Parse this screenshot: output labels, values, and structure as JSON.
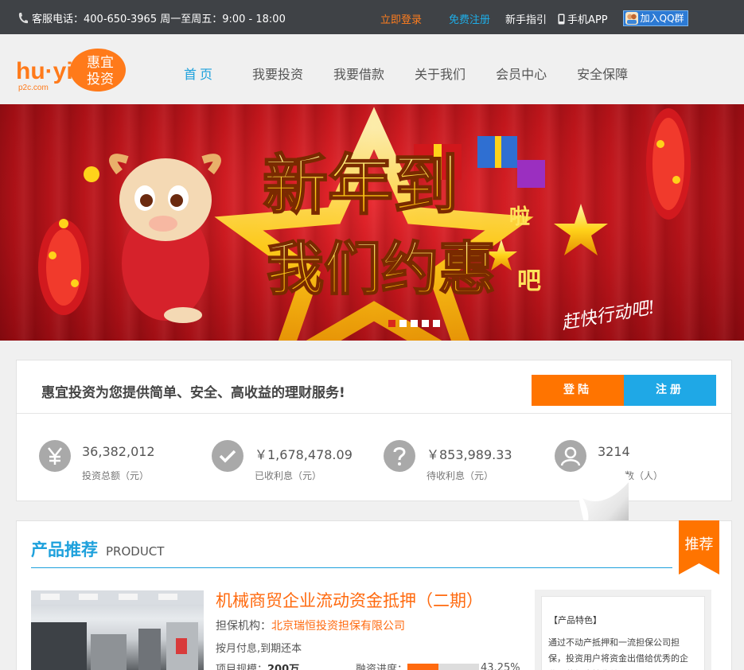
{
  "topbar": {
    "hotline": "客服电话：400-650-3965 周一至周五：9:00 - 18:00",
    "login": "立即登录",
    "register": "免费注册",
    "guide": "新手指引",
    "app": "手机APP",
    "qq_group": "加入QQ群"
  },
  "logo": {
    "en": "hu·yi",
    "domain": "p2c.com",
    "cn_line1": "惠宜",
    "cn_line2": "投资"
  },
  "nav": {
    "items": [
      "首页",
      "我要投资",
      "我要借款",
      "关于我们",
      "会员中心",
      "安全保障"
    ]
  },
  "banner": {
    "headline1": "新年到",
    "headline1_suffix": "啦",
    "headline2": "我们约惠",
    "headline2_suffix": "吧",
    "tagline": "赶快行动吧!",
    "slide_count": 5,
    "active_slide": 1
  },
  "summary": {
    "slogan": "惠宜投资为您提供简单、安全、高收益的理财服务!",
    "login_button": "登陆",
    "register_button": "注册",
    "stats": [
      {
        "icon": "yen-icon",
        "value": "36,382,012",
        "label": "投资总额（元）"
      },
      {
        "icon": "check-icon",
        "value": "￥1,678,478.09",
        "label": "已收利息（元）"
      },
      {
        "icon": "question-icon",
        "value": "￥853,989.33",
        "label": "待收利息（元）"
      },
      {
        "icon": "user-icon",
        "value": "3214",
        "label": "数（人）"
      }
    ]
  },
  "product": {
    "section_title": "产品推荐",
    "section_title_en": "PRODUCT",
    "ribbon": "推荐",
    "name": "机械商贸企业流动资金抵押（二期）",
    "guarantor_label": "担保机构：",
    "guarantor": "北京瑞恒投资担保有限公司",
    "repayment": "按月付息,到期还本",
    "scale_label": "项目规模：",
    "scale_value": "200万",
    "progress_label": "融资进度：",
    "progress_value": 0.4325,
    "progress_text": "43.25%",
    "feature_title": "【产品特色】",
    "feature_desc": "通过不动产抵押和一流担保公司担保，投资用户将资金出借给优秀的企业，获得稳健收益！"
  },
  "colors": {
    "accent_blue": "#1ea1dc",
    "accent_orange": "#ff7400",
    "topbar": "#3f4246"
  }
}
